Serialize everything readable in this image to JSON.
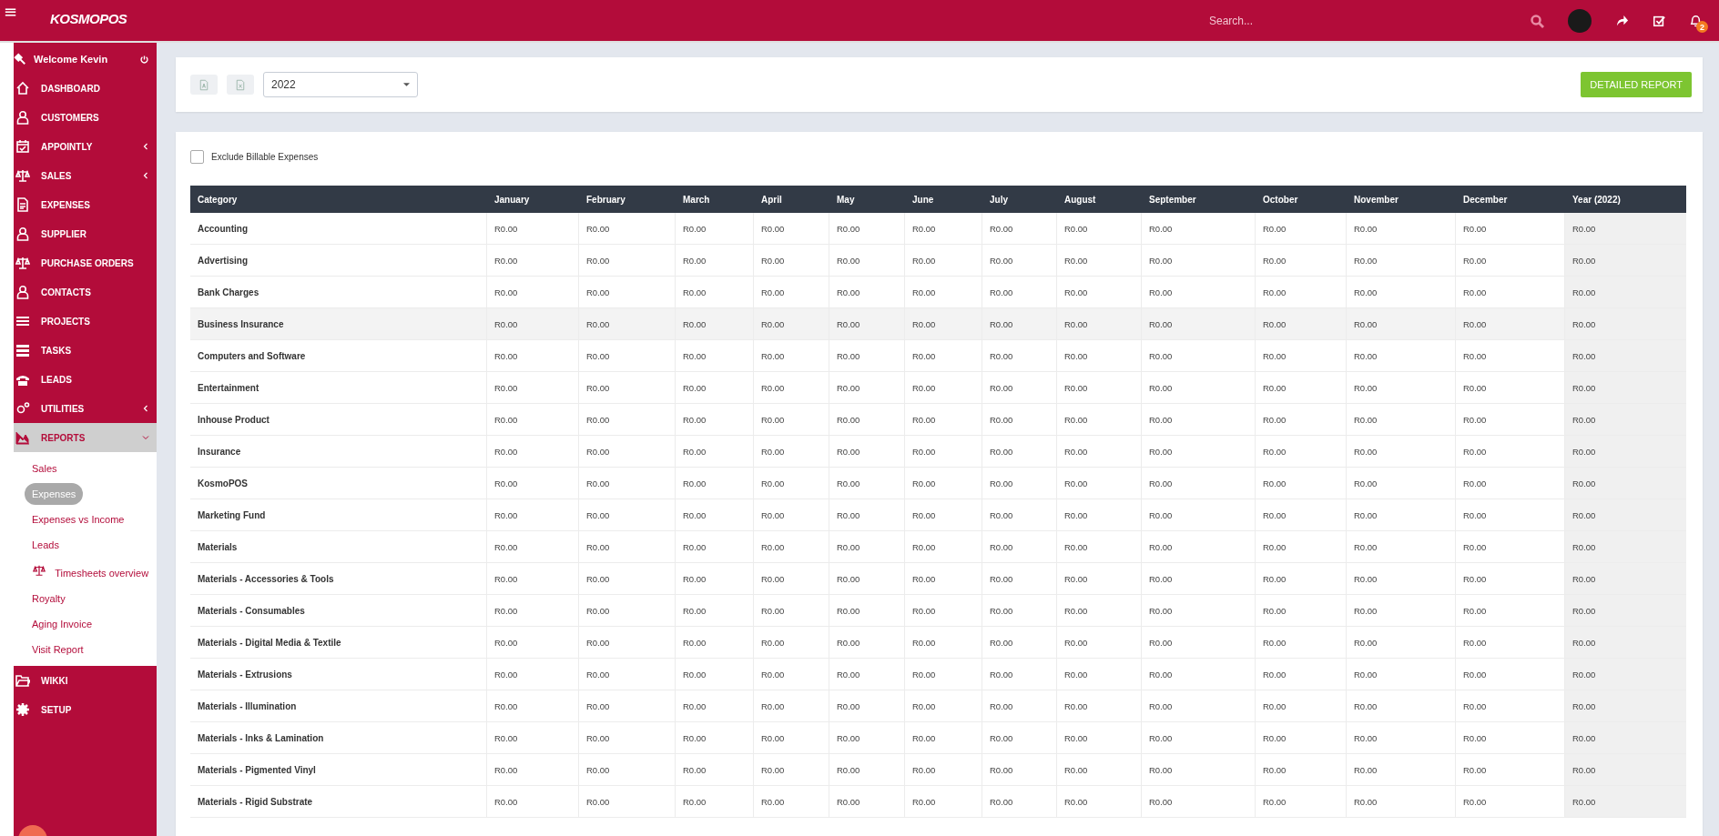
{
  "topbar": {
    "menu": "≡",
    "logo": "KOSMOPOS",
    "search": {
      "placeholder": "Search..."
    },
    "notifications": "2"
  },
  "sidebar": {
    "welcome": "Welcome Kevin",
    "items": [
      {
        "label": "DASHBOARD",
        "selected": false
      },
      {
        "label": "CUSTOMERS",
        "selected": false
      },
      {
        "label": "APPOINTLY",
        "selected": false,
        "expanded": false
      },
      {
        "label": "SALES",
        "selected": false,
        "expanded": false
      },
      {
        "label": "EXPENSES",
        "selected": false
      },
      {
        "label": "SUPPLIER",
        "selected": false
      },
      {
        "label": "PURCHASE ORDERS",
        "selected": false
      },
      {
        "label": "CONTACTS",
        "selected": false
      },
      {
        "label": "PROJECTS",
        "selected": false
      },
      {
        "label": "TASKS",
        "selected": false
      },
      {
        "label": "LEADS",
        "selected": false
      },
      {
        "label": "UTILITIES",
        "selected": false,
        "expanded": false
      },
      {
        "label": "REPORTS",
        "selected": true,
        "expanded": true,
        "children": [
          {
            "label": "Sales",
            "selected": false
          },
          {
            "label": "Expenses",
            "selected": true
          },
          {
            "label": "Expenses vs Income",
            "selected": false
          },
          {
            "label": "Leads",
            "selected": false
          },
          {
            "label": "Timesheets overview",
            "selected": false,
            "icon": true
          },
          {
            "label": "Royalty",
            "selected": false
          },
          {
            "label": "Aging Invoice",
            "selected": false
          },
          {
            "label": "Visit Report",
            "selected": false
          }
        ]
      },
      {
        "label": "WIKKI",
        "selected": false
      },
      {
        "label": "SETUP",
        "selected": false
      }
    ]
  },
  "toolbar": {
    "year": "2022",
    "button": "DETAILED REPORT"
  },
  "filter": {
    "label": "Exclude Billable Expenses",
    "checked": false
  },
  "table": {
    "columns": [
      "Category",
      "January",
      "February",
      "March",
      "April",
      "May",
      "June",
      "July",
      "August",
      "September",
      "October",
      "November",
      "December",
      "Year (2022)"
    ],
    "rows": [
      {
        "category": "Accounting",
        "highlighted": false,
        "values": [
          "R0.00",
          "R0.00",
          "R0.00",
          "R0.00",
          "R0.00",
          "R0.00",
          "R0.00",
          "R0.00",
          "R0.00",
          "R0.00",
          "R0.00",
          "R0.00",
          "R0.00"
        ]
      },
      {
        "category": "Advertising",
        "highlighted": false,
        "values": [
          "R0.00",
          "R0.00",
          "R0.00",
          "R0.00",
          "R0.00",
          "R0.00",
          "R0.00",
          "R0.00",
          "R0.00",
          "R0.00",
          "R0.00",
          "R0.00",
          "R0.00"
        ]
      },
      {
        "category": "Bank Charges",
        "highlighted": false,
        "values": [
          "R0.00",
          "R0.00",
          "R0.00",
          "R0.00",
          "R0.00",
          "R0.00",
          "R0.00",
          "R0.00",
          "R0.00",
          "R0.00",
          "R0.00",
          "R0.00",
          "R0.00"
        ]
      },
      {
        "category": "Business Insurance",
        "highlighted": true,
        "values": [
          "R0.00",
          "R0.00",
          "R0.00",
          "R0.00",
          "R0.00",
          "R0.00",
          "R0.00",
          "R0.00",
          "R0.00",
          "R0.00",
          "R0.00",
          "R0.00",
          "R0.00"
        ]
      },
      {
        "category": "Computers and Software",
        "highlighted": false,
        "values": [
          "R0.00",
          "R0.00",
          "R0.00",
          "R0.00",
          "R0.00",
          "R0.00",
          "R0.00",
          "R0.00",
          "R0.00",
          "R0.00",
          "R0.00",
          "R0.00",
          "R0.00"
        ]
      },
      {
        "category": "Entertainment",
        "highlighted": false,
        "values": [
          "R0.00",
          "R0.00",
          "R0.00",
          "R0.00",
          "R0.00",
          "R0.00",
          "R0.00",
          "R0.00",
          "R0.00",
          "R0.00",
          "R0.00",
          "R0.00",
          "R0.00"
        ]
      },
      {
        "category": "Inhouse Product",
        "highlighted": false,
        "values": [
          "R0.00",
          "R0.00",
          "R0.00",
          "R0.00",
          "R0.00",
          "R0.00",
          "R0.00",
          "R0.00",
          "R0.00",
          "R0.00",
          "R0.00",
          "R0.00",
          "R0.00"
        ]
      },
      {
        "category": "Insurance",
        "highlighted": false,
        "values": [
          "R0.00",
          "R0.00",
          "R0.00",
          "R0.00",
          "R0.00",
          "R0.00",
          "R0.00",
          "R0.00",
          "R0.00",
          "R0.00",
          "R0.00",
          "R0.00",
          "R0.00"
        ]
      },
      {
        "category": "KosmoPOS",
        "highlighted": false,
        "values": [
          "R0.00",
          "R0.00",
          "R0.00",
          "R0.00",
          "R0.00",
          "R0.00",
          "R0.00",
          "R0.00",
          "R0.00",
          "R0.00",
          "R0.00",
          "R0.00",
          "R0.00"
        ]
      },
      {
        "category": "Marketing Fund",
        "highlighted": false,
        "values": [
          "R0.00",
          "R0.00",
          "R0.00",
          "R0.00",
          "R0.00",
          "R0.00",
          "R0.00",
          "R0.00",
          "R0.00",
          "R0.00",
          "R0.00",
          "R0.00",
          "R0.00"
        ]
      },
      {
        "category": "Materials",
        "highlighted": false,
        "values": [
          "R0.00",
          "R0.00",
          "R0.00",
          "R0.00",
          "R0.00",
          "R0.00",
          "R0.00",
          "R0.00",
          "R0.00",
          "R0.00",
          "R0.00",
          "R0.00",
          "R0.00"
        ]
      },
      {
        "category": "Materials - Accessories & Tools",
        "highlighted": false,
        "values": [
          "R0.00",
          "R0.00",
          "R0.00",
          "R0.00",
          "R0.00",
          "R0.00",
          "R0.00",
          "R0.00",
          "R0.00",
          "R0.00",
          "R0.00",
          "R0.00",
          "R0.00"
        ]
      },
      {
        "category": "Materials - Consumables",
        "highlighted": false,
        "values": [
          "R0.00",
          "R0.00",
          "R0.00",
          "R0.00",
          "R0.00",
          "R0.00",
          "R0.00",
          "R0.00",
          "R0.00",
          "R0.00",
          "R0.00",
          "R0.00",
          "R0.00"
        ]
      },
      {
        "category": "Materials - Digital Media & Textile",
        "highlighted": false,
        "values": [
          "R0.00",
          "R0.00",
          "R0.00",
          "R0.00",
          "R0.00",
          "R0.00",
          "R0.00",
          "R0.00",
          "R0.00",
          "R0.00",
          "R0.00",
          "R0.00",
          "R0.00"
        ]
      },
      {
        "category": "Materials - Extrusions",
        "highlighted": false,
        "values": [
          "R0.00",
          "R0.00",
          "R0.00",
          "R0.00",
          "R0.00",
          "R0.00",
          "R0.00",
          "R0.00",
          "R0.00",
          "R0.00",
          "R0.00",
          "R0.00",
          "R0.00"
        ]
      },
      {
        "category": "Materials - Illumination",
        "highlighted": false,
        "values": [
          "R0.00",
          "R0.00",
          "R0.00",
          "R0.00",
          "R0.00",
          "R0.00",
          "R0.00",
          "R0.00",
          "R0.00",
          "R0.00",
          "R0.00",
          "R0.00",
          "R0.00"
        ]
      },
      {
        "category": "Materials - Inks & Lamination",
        "highlighted": false,
        "values": [
          "R0.00",
          "R0.00",
          "R0.00",
          "R0.00",
          "R0.00",
          "R0.00",
          "R0.00",
          "R0.00",
          "R0.00",
          "R0.00",
          "R0.00",
          "R0.00",
          "R0.00"
        ]
      },
      {
        "category": "Materials - Pigmented Vinyl",
        "highlighted": false,
        "values": [
          "R0.00",
          "R0.00",
          "R0.00",
          "R0.00",
          "R0.00",
          "R0.00",
          "R0.00",
          "R0.00",
          "R0.00",
          "R0.00",
          "R0.00",
          "R0.00",
          "R0.00"
        ]
      },
      {
        "category": "Materials - Rigid Substrate",
        "highlighted": false,
        "values": [
          "R0.00",
          "R0.00",
          "R0.00",
          "R0.00",
          "R0.00",
          "R0.00",
          "R0.00",
          "R0.00",
          "R0.00",
          "R0.00",
          "R0.00",
          "R0.00",
          "R0.00"
        ]
      }
    ]
  }
}
